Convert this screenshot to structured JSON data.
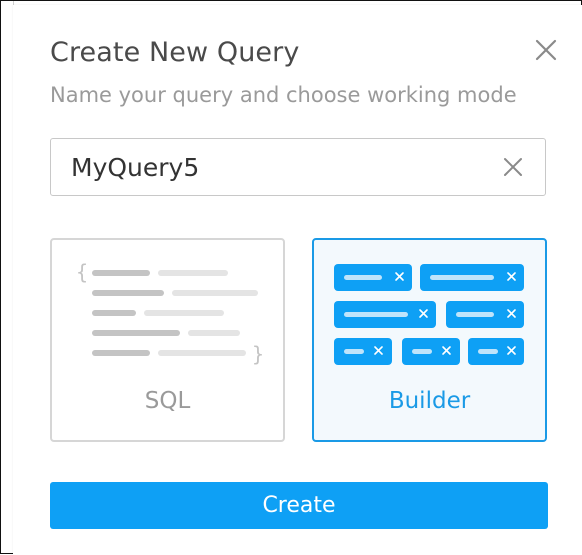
{
  "dialog": {
    "title": "Create New Query",
    "subtitle": "Name your query and choose working mode",
    "close_icon": "close-icon"
  },
  "query_name": {
    "value": "MyQuery5",
    "clear_icon": "clear-icon"
  },
  "modes": {
    "selected": "Builder",
    "sql": {
      "label": "SQL",
      "icon": "sql-code-illustration"
    },
    "builder": {
      "label": "Builder",
      "icon": "builder-chips-illustration"
    }
  },
  "actions": {
    "create_label": "Create"
  },
  "colors": {
    "accent": "#0ea0f5",
    "accent_border": "#1a9ae6",
    "chip": "#0ea0f5",
    "chip_bar": "#bfe4fb",
    "code_dark": "#c4c4c4",
    "code_light": "#e4e4e4",
    "title_text": "#4a4a4a",
    "subtitle_text": "#9a9a9a"
  }
}
